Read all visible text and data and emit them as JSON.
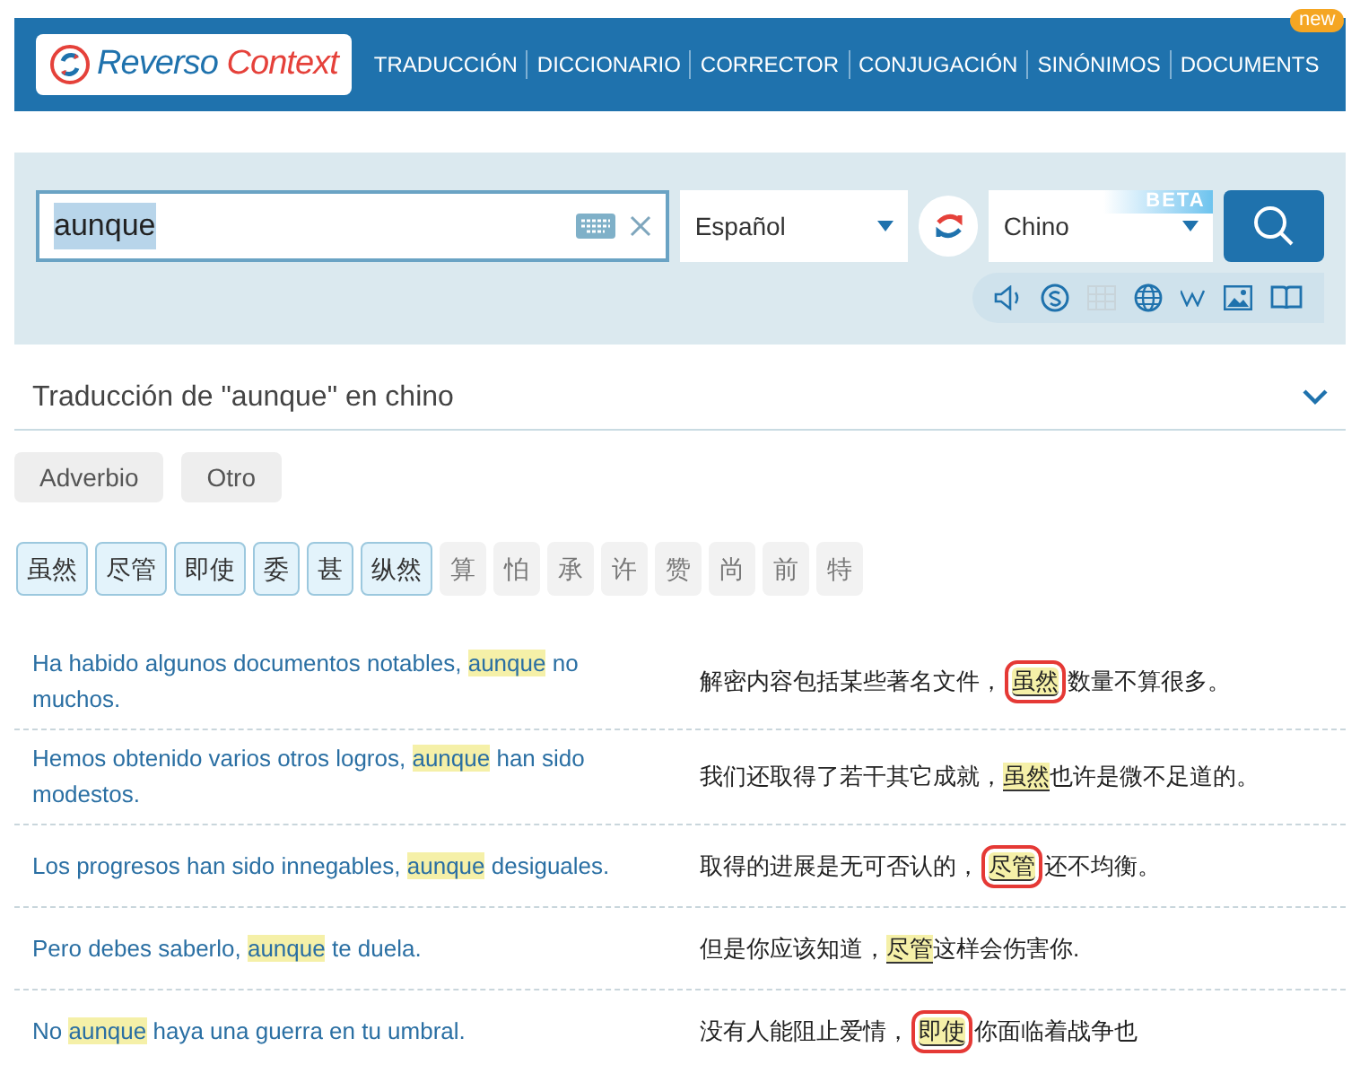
{
  "header": {
    "logo": {
      "word1": "Reverso",
      "word2": "Context"
    },
    "nav": [
      {
        "label": "TRADUCCIÓN"
      },
      {
        "label": "DICCIONARIO"
      },
      {
        "label": "CORRECTOR"
      },
      {
        "label": "CONJUGACIÓN"
      },
      {
        "label": "SINÓNIMOS"
      },
      {
        "label": "DOCUMENTS",
        "badge": "new"
      }
    ]
  },
  "search": {
    "value": "aunque",
    "source_language": "Español",
    "target_language": "Chino",
    "target_badge": "BETA"
  },
  "section": {
    "title": "Traducción de \"aunque\" en chino",
    "expanded": true
  },
  "categories": [
    {
      "label": "Adverbio"
    },
    {
      "label": "Otro"
    }
  ],
  "translations": [
    {
      "text": "虽然",
      "verified": true
    },
    {
      "text": "尽管",
      "verified": true
    },
    {
      "text": "即使",
      "verified": true
    },
    {
      "text": "委",
      "verified": true
    },
    {
      "text": "甚",
      "verified": true
    },
    {
      "text": "纵然",
      "verified": true
    },
    {
      "text": "算",
      "verified": false
    },
    {
      "text": "怕",
      "verified": false
    },
    {
      "text": "承",
      "verified": false
    },
    {
      "text": "许",
      "verified": false
    },
    {
      "text": "赞",
      "verified": false
    },
    {
      "text": "尚",
      "verified": false
    },
    {
      "text": "前",
      "verified": false
    },
    {
      "text": "特",
      "verified": false
    }
  ],
  "examples": [
    {
      "source": [
        "Ha habido algunos documentos notables, ",
        "aunque",
        " no muchos."
      ],
      "target": [
        "解密内容包括某些著名文件，",
        "虽然",
        "数量不算很多。"
      ],
      "circled": true
    },
    {
      "source": [
        "Hemos obtenido varios otros logros, ",
        "aunque",
        " han sido modestos."
      ],
      "target": [
        "我们还取得了若干其它成就，",
        "虽然",
        "也许是微不足道的。"
      ],
      "circled": false
    },
    {
      "source": [
        "Los progresos han sido innegables, ",
        "aunque",
        " desiguales."
      ],
      "target": [
        "取得的进展是无可否认的，",
        "尽管",
        "还不均衡。"
      ],
      "circled": true
    },
    {
      "source": [
        "Pero debes saberlo, ",
        "aunque",
        " te duela."
      ],
      "target": [
        "但是你应该知道，",
        "尽管",
        "这样会伤害你."
      ],
      "circled": false
    },
    {
      "source": [
        "No ",
        "aunque",
        " haya una guerra en tu umbral."
      ],
      "target": [
        "没有人能阻止爱情，",
        "即使",
        "你面临着战争也"
      ],
      "circled": true
    }
  ]
}
